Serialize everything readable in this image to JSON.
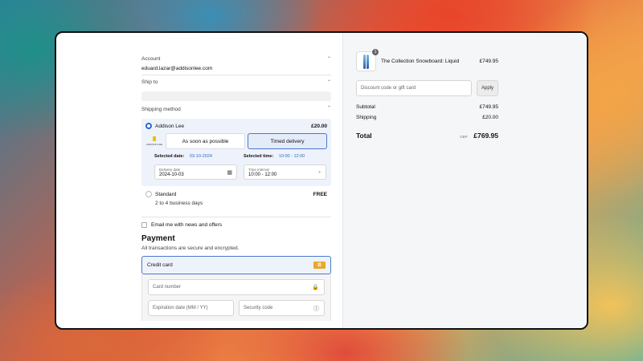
{
  "account": {
    "label": "Account",
    "email": "eduard.lazar@addisonlee.com"
  },
  "ship_to": {
    "label": "Ship to"
  },
  "shipping_method": {
    "label": "Shipping method",
    "options": [
      {
        "name": "Addison Lee",
        "price": "£20.00",
        "selected": true,
        "logo_text": "ADDISON LEE",
        "delivery_tabs": [
          "As soon as possible",
          "Timed delivery"
        ],
        "selected_tab": "Timed delivery",
        "selected_date_label": "Selected date:",
        "selected_date": "03-10-2024",
        "selected_time_label": "Selected time:",
        "selected_time": "10:00 - 12:00",
        "delivery_date_label": "Delivery date",
        "delivery_date_value": "2024-10-03",
        "time_interval_label": "Time interval",
        "time_interval_value": "10:00 - 12:00"
      },
      {
        "name": "Standard",
        "subtitle": "2 to 4 business days",
        "price": "FREE",
        "selected": false
      }
    ]
  },
  "newsletter": {
    "label": "Email me with news and offers",
    "checked": false
  },
  "payment": {
    "title": "Payment",
    "subtitle": "All transactions are secure and encrypted.",
    "method_label": "Credit card",
    "badge": "B",
    "card_number_placeholder": "Card number",
    "expiration_placeholder": "Expiration date (MM / YY)",
    "security_code_placeholder": "Security code"
  },
  "order": {
    "product": {
      "name": "The Collection Snowboard: Liquid",
      "price": "£749.95",
      "quantity": "1"
    },
    "discount_placeholder": "Discount code or gift card",
    "apply_label": "Apply",
    "subtotal_label": "Subtotal",
    "subtotal": "£749.95",
    "shipping_label": "Shipping",
    "shipping": "£20.00",
    "total_label": "Total",
    "currency": "GBP",
    "total": "£769.95"
  },
  "colors": {
    "accent": "#2f67c9",
    "badge": "#e8a92e",
    "summary_bg": "#f5f6f8"
  }
}
